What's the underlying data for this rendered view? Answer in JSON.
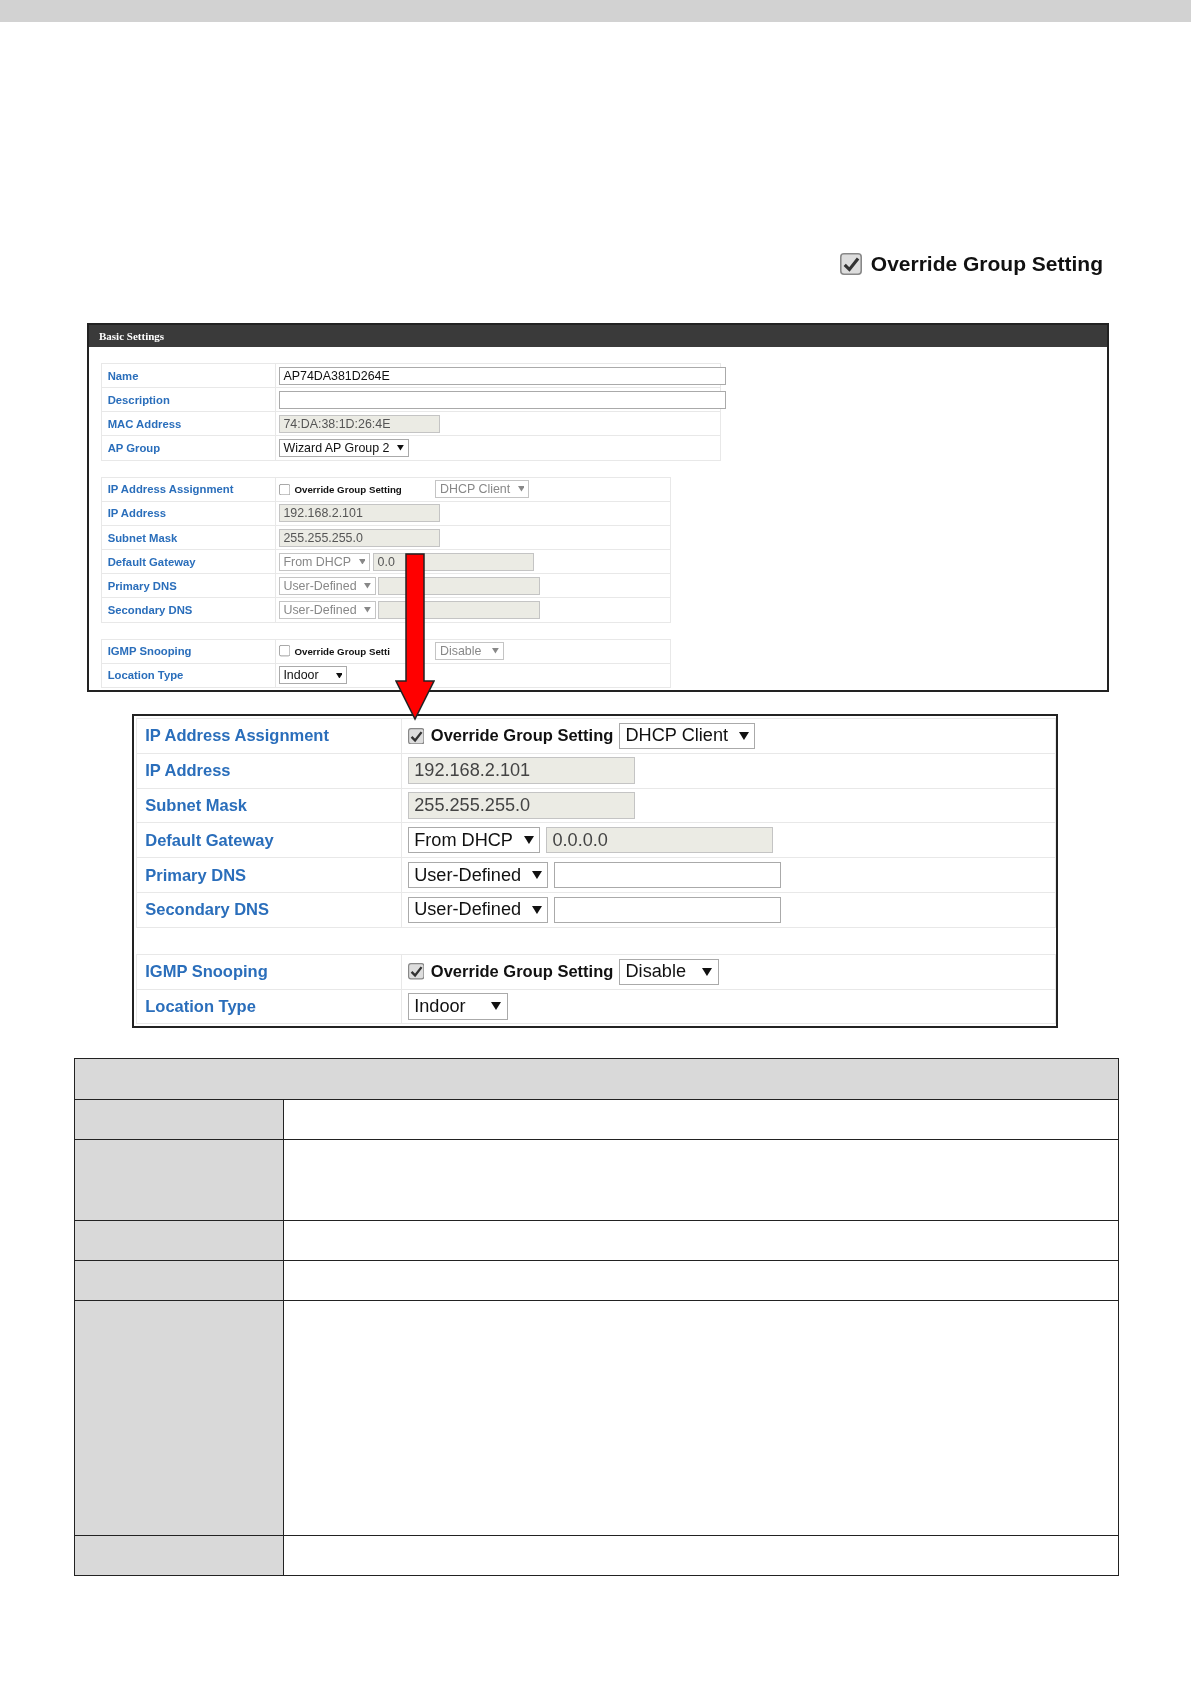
{
  "top_option": {
    "label": "Override Group Setting",
    "checked": true
  },
  "basic_settings": {
    "title": "Basic Settings",
    "groups": [
      {
        "rows": [
          {
            "label": "Name",
            "controls": [
              {
                "kind": "wide-input",
                "value": "AP74DA381D264E",
                "disabled": false
              }
            ]
          },
          {
            "label": "Description",
            "controls": [
              {
                "kind": "wide-input",
                "disabled": false
              }
            ]
          },
          {
            "label": "MAC Address",
            "controls": [
              {
                "kind": "input",
                "value": "74:DA:38:1D:26:4E",
                "disabled": true
              }
            ]
          },
          {
            "label": "AP Group",
            "controls": [
              {
                "kind": "select",
                "value": "Wizard AP Group 2",
                "disabled": false
              }
            ]
          }
        ]
      },
      {
        "rows": [
          {
            "label": "IP Address Assignment",
            "controls": [
              {
                "kind": "checkbox",
                "label": "Override Group Setting",
                "checked": false
              },
              {
                "kind": "select",
                "value": "DHCP Client",
                "disabled": true
              }
            ]
          },
          {
            "label": "IP Address",
            "controls": [
              {
                "kind": "input",
                "value": "192.168.2.101",
                "disabled": true
              }
            ]
          },
          {
            "label": "Subnet Mask",
            "controls": [
              {
                "kind": "input",
                "value": "255.255.255.0",
                "disabled": true
              }
            ]
          },
          {
            "label": "Default Gateway",
            "controls": [
              {
                "kind": "select",
                "value": "From DHCP",
                "disabled": true
              },
              {
                "kind": "input",
                "value": "0.0",
                "disabled": true
              }
            ]
          },
          {
            "label": "Primary DNS",
            "controls": [
              {
                "kind": "select",
                "value": "User-Defined",
                "disabled": true
              },
              {
                "kind": "input",
                "disabled": true
              }
            ]
          },
          {
            "label": "Secondary DNS",
            "controls": [
              {
                "kind": "select",
                "value": "User-Defined",
                "disabled": true
              },
              {
                "kind": "input",
                "disabled": true
              }
            ]
          }
        ]
      },
      {
        "rows": [
          {
            "label": "IGMP Snooping",
            "controls": [
              {
                "kind": "checkbox",
                "label": "Override Group Setti",
                "checked": false
              },
              {
                "kind": "select",
                "value": "Disable",
                "disabled": true
              }
            ]
          },
          {
            "label": "Location Type",
            "controls": [
              {
                "kind": "select",
                "value": "Indoor",
                "disabled": false
              }
            ]
          }
        ]
      }
    ]
  },
  "detail": {
    "groups": [
      {
        "rows": [
          {
            "label": "IP Address Assignment",
            "controls": [
              {
                "kind": "checkbox",
                "label": "Override Group Setting",
                "checked": true
              },
              {
                "kind": "select",
                "value": "DHCP Client",
                "disabled": false
              }
            ]
          },
          {
            "label": "IP Address",
            "controls": [
              {
                "kind": "input",
                "value": "192.168.2.101",
                "disabled": true
              }
            ]
          },
          {
            "label": "Subnet Mask",
            "controls": [
              {
                "kind": "input",
                "value": "255.255.255.0",
                "disabled": true
              }
            ]
          },
          {
            "label": "Default Gateway",
            "controls": [
              {
                "kind": "select",
                "value": "From DHCP",
                "disabled": false
              },
              {
                "kind": "input",
                "value": "0.0.0.0",
                "disabled": true
              }
            ]
          },
          {
            "label": "Primary DNS",
            "controls": [
              {
                "kind": "select",
                "value": "User-Defined",
                "disabled": false
              },
              {
                "kind": "input",
                "disabled": false
              }
            ]
          },
          {
            "label": "Secondary DNS",
            "controls": [
              {
                "kind": "select",
                "value": "User-Defined",
                "disabled": false
              },
              {
                "kind": "input",
                "disabled": false
              }
            ]
          }
        ]
      },
      {
        "rows": [
          {
            "label": "IGMP Snooping",
            "controls": [
              {
                "kind": "checkbox",
                "label": "Override Group Setting",
                "checked": true
              },
              {
                "kind": "select",
                "value": "Disable",
                "disabled": false
              }
            ]
          },
          {
            "label": "Location Type",
            "controls": [
              {
                "kind": "select",
                "value": "Indoor",
                "disabled": false
              }
            ]
          }
        ]
      }
    ]
  },
  "table": {
    "rows": [
      {
        "kind": "header"
      },
      {
        "kind": "row"
      },
      {
        "kind": "tall"
      },
      {
        "kind": "row"
      },
      {
        "kind": "row"
      },
      {
        "kind": "tallest"
      },
      {
        "kind": "row"
      }
    ]
  }
}
